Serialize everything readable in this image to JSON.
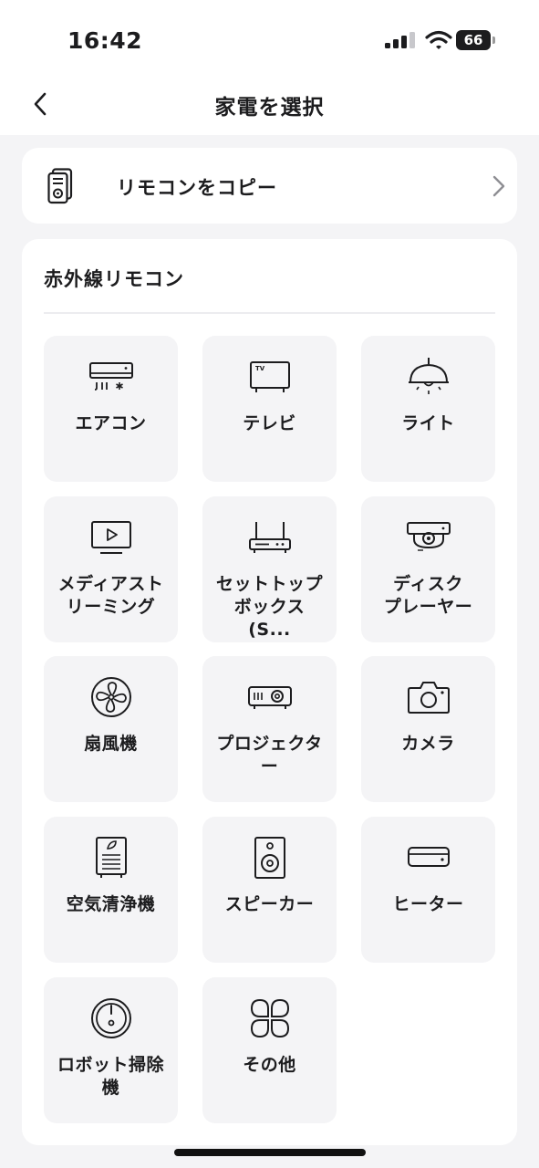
{
  "status_bar": {
    "time": "16:42",
    "battery": "66"
  },
  "header": {
    "title": "家電を選択"
  },
  "copy_remote": {
    "label": "リモコンをコピー"
  },
  "ir_section": {
    "title": "赤外線リモコン",
    "devices": [
      {
        "label_line1": "エアコン",
        "label_line2": "",
        "icon": "air-conditioner-icon"
      },
      {
        "label_line1": "テレビ",
        "label_line2": "",
        "icon": "tv-icon"
      },
      {
        "label_line1": "ライト",
        "label_line2": "",
        "icon": "pendant-light-icon"
      },
      {
        "label_line1": "メディアスト",
        "label_line2": "リーミング",
        "icon": "media-streaming-icon"
      },
      {
        "label_line1": "セットトップ",
        "label_line2": "ボックス (S...",
        "icon": "set-top-box-icon"
      },
      {
        "label_line1": "ディスク",
        "label_line2": "プレーヤー",
        "icon": "disc-player-icon"
      },
      {
        "label_line1": "扇風機",
        "label_line2": "",
        "icon": "fan-icon"
      },
      {
        "label_line1": "プロジェクタ",
        "label_line2": "ー",
        "icon": "projector-icon"
      },
      {
        "label_line1": "カメラ",
        "label_line2": "",
        "icon": "camera-icon"
      },
      {
        "label_line1": "空気清浄機",
        "label_line2": "",
        "icon": "air-purifier-icon"
      },
      {
        "label_line1": "スピーカー",
        "label_line2": "",
        "icon": "speaker-icon"
      },
      {
        "label_line1": "ヒーター",
        "label_line2": "",
        "icon": "heater-icon"
      },
      {
        "label_line1": "ロボット掃除",
        "label_line2": "機",
        "icon": "robot-vacuum-icon"
      },
      {
        "label_line1": "その他",
        "label_line2": "",
        "icon": "other-clover-icon"
      }
    ]
  }
}
